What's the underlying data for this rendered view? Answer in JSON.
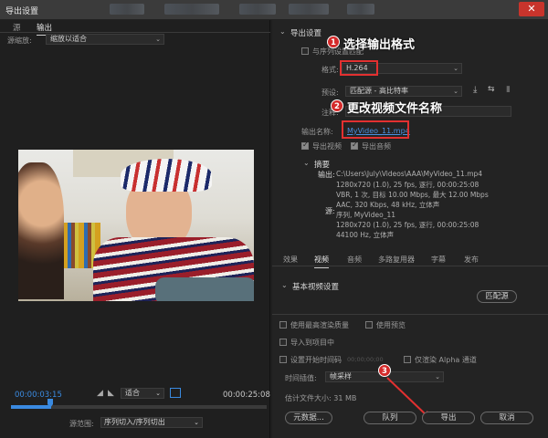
{
  "window": {
    "title": "导出设置",
    "close_glyph": "✕"
  },
  "left": {
    "tabs": [
      "源",
      "输出"
    ],
    "scale_label": "源缩放:",
    "scale_value": "缩放以适合",
    "time_in": "00:00:03:15",
    "fit_value": "适合",
    "time_end": "00:00:25:08",
    "source_range_label": "源范围:",
    "source_range_value": "序列切入/序列切出"
  },
  "export": {
    "section_title": "导出设置",
    "match_seq_label": "与序列设置匹配",
    "format_label": "格式:",
    "format_value": "H.264",
    "preset_label": "预设:",
    "preset_value": "匹配源 - 高比特率",
    "comment_label": "注释:",
    "output_name_label": "输出名称:",
    "output_name_value": "MyVideo_11.mp4",
    "export_video_label": "导出视频",
    "export_audio_label": "导出音频"
  },
  "annotations": {
    "a1_num": "1",
    "a1_text": "选择输出格式",
    "a2_num": "2",
    "a2_text": "更改视频文件名称",
    "a3_num": "3"
  },
  "summary": {
    "title": "摘要",
    "output_label": "输出:",
    "output_lines": [
      "C:\\Users\\July\\Videos\\AAA\\MyVideo_11.mp4",
      "1280x720 (1.0), 25 fps, 逐行, 00:00:25:08",
      "VBR, 1 次, 目标 10.00 Mbps, 最大 12.00 Mbps",
      "AAC, 320 Kbps, 48 kHz, 立体声"
    ],
    "source_label": "源:",
    "source_lines": [
      "序列, MyVideo_11",
      "1280x720 (1.0), 25 fps, 逐行, 00:00:25:08",
      "44100 Hz, 立体声"
    ]
  },
  "tabs": [
    "效果",
    "视频",
    "音频",
    "多路复用器",
    "字幕",
    "发布"
  ],
  "video_tab": {
    "section_title": "基本视频设置",
    "match_source_button": "匹配源"
  },
  "options": {
    "max_render_quality": "使用最高渲染质量",
    "use_previews": "使用预览",
    "import_into_project": "导入到项目中",
    "set_start_timecode": "设置开始时间码",
    "start_timecode_value": "00;00;00;00",
    "render_alpha_only": "仅渲染 Alpha 通道",
    "time_interp_label": "时间插值:",
    "time_interp_value": "帧采样",
    "estimated_size": "估计文件大小: 31 MB"
  },
  "buttons": {
    "metadata": "元数据...",
    "queue": "队列",
    "export": "导出",
    "cancel": "取消"
  },
  "colors": {
    "accent": "#3a8ae0",
    "annotation_red": "#e23030",
    "output_link": "#4a90e0"
  }
}
